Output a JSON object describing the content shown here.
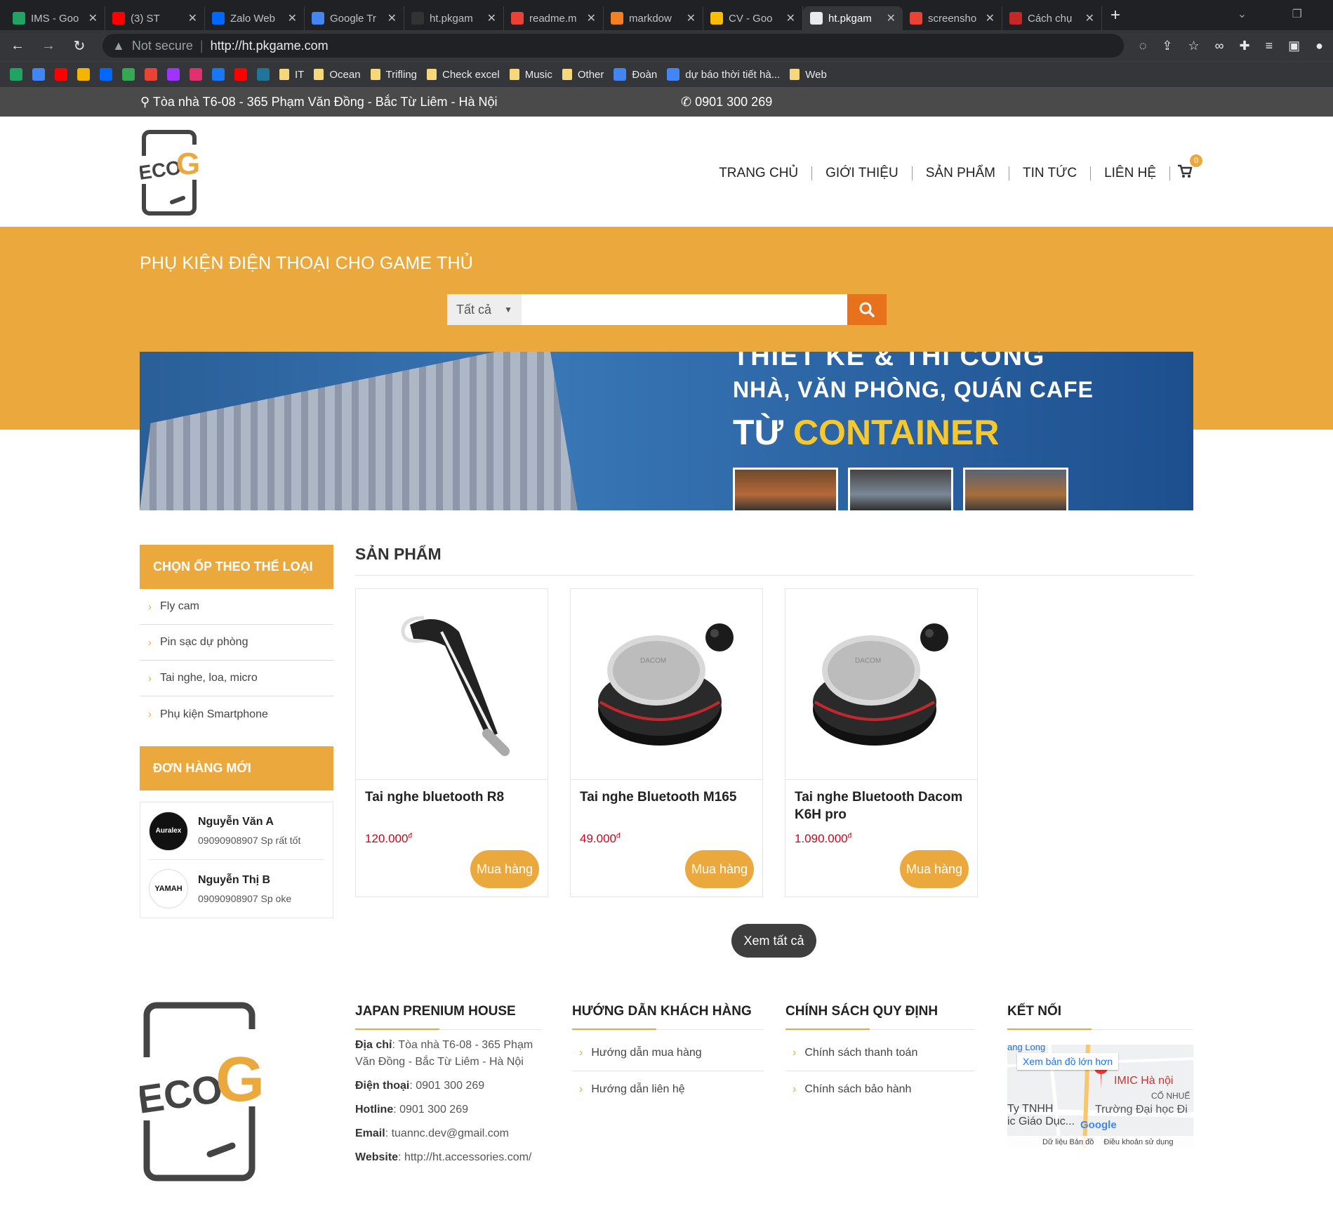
{
  "browser": {
    "tabs": [
      {
        "title": "IMS - Goo",
        "color": "#1fa463"
      },
      {
        "title": "(3) ST",
        "color": "#ff0000"
      },
      {
        "title": "Zalo Web",
        "color": "#0068ff"
      },
      {
        "title": "Google Tr",
        "color": "#4285f4"
      },
      {
        "title": "ht.pkgam",
        "color": "#333333"
      },
      {
        "title": "readme.m",
        "color": "#ea4335"
      },
      {
        "title": "markdow",
        "color": "#f48024"
      },
      {
        "title": "CV - Goo",
        "color": "#fbbc04"
      },
      {
        "title": "ht.pkgam",
        "color": "#e8eaed",
        "active": true
      },
      {
        "title": "screensho",
        "color": "#ea4335"
      },
      {
        "title": "Cách chụ",
        "color": "#c62828"
      }
    ],
    "security": "Not secure",
    "url": "http://ht.pkgame.com",
    "bookmarks": [
      {
        "label": "IT",
        "folder": true
      },
      {
        "label": "Ocean",
        "folder": true
      },
      {
        "label": "Trifling",
        "folder": true
      },
      {
        "label": "Check excel",
        "folder": true
      },
      {
        "label": "Music",
        "folder": true
      },
      {
        "label": "Other",
        "folder": true
      },
      {
        "label": "Đoàn",
        "folder": false
      },
      {
        "label": "dự báo thời tiết hà...",
        "folder": false
      },
      {
        "label": "Web",
        "folder": true
      }
    ]
  },
  "topbar": {
    "address": "Tòa nhà T6-08 - 365 Phạm Văn Đồng - Bắc Từ Liêm - Hà Nội",
    "phone": "0901 300 269"
  },
  "nav": {
    "items": [
      "TRANG CHỦ",
      "GIỚI THIỆU",
      "SẢN PHẨM",
      "TIN TỨC",
      "LIÊN HỆ"
    ],
    "cart_count": "0"
  },
  "logo": {
    "eco": "ECO",
    "g": "G"
  },
  "hero": {
    "title": "PHỤ KIỆN ĐIỆN THOẠI CHO GAME THỦ",
    "search_category": "Tất cả",
    "search_placeholder": ""
  },
  "banner": {
    "line1": "THIẾT KẾ & THI CÔNG",
    "line2": "NHÀ, VĂN PHÒNG, QUÁN CAFE",
    "line3_prefix": "TỪ",
    "line3_highlight": "CONTAINER"
  },
  "sidebar": {
    "categories_title": "CHỌN ỐP THEO THỂ LOẠI",
    "categories": [
      "Fly cam",
      "Pin sạc dự phòng",
      "Tai nghe, loa, micro",
      "Phụ kiện Smartphone"
    ],
    "orders_title": "ĐƠN HÀNG MỚI",
    "orders": [
      {
        "name": "Nguyễn Văn A",
        "message": "09090908907 Sp rất tốt",
        "avatar": "Auralex"
      },
      {
        "name": "Nguyễn Thị B",
        "message": "09090908907 Sp oke",
        "avatar": "YAMAH"
      }
    ]
  },
  "products": {
    "title": "SẢN PHẨM",
    "items": [
      {
        "name": "Tai nghe bluetooth R8",
        "price": "120.000",
        "currency": "đ",
        "buy": "Mua hàng"
      },
      {
        "name": "Tai nghe Bluetooth M165",
        "price": "49.000",
        "currency": "đ",
        "buy": "Mua hàng"
      },
      {
        "name": "Tai nghe Bluetooth Dacom K6H pro",
        "price": "1.090.000",
        "currency": "đ",
        "buy": "Mua hàng"
      }
    ],
    "view_all": "Xem tất cả"
  },
  "footer": {
    "company_title": "JAPAN PRENIUM HOUSE",
    "address_label": "Địa chỉ",
    "address": "Tòa nhà T6-08 - 365 Phạm Văn Đồng - Bắc Từ Liêm - Hà Nội",
    "phone_label": "Điện thoại",
    "phone": "0901 300 269",
    "hotline_label": "Hotline",
    "hotline": "0901 300 269",
    "email_label": "Email",
    "email": "tuannc.dev@gmail.com",
    "website_label": "Website",
    "website": "http://ht.accessories.com/",
    "guide_title": "HƯỚNG DẪN KHÁCH HÀNG",
    "guide_links": [
      "Hướng dẫn mua hàng",
      "Hướng dẫn liên hệ"
    ],
    "policy_title": "CHÍNH SÁCH QUY ĐỊNH",
    "policy_links": [
      "Chính sách thanh toán",
      "Chính sách bảo hành"
    ],
    "connect_title": "KẾT NỐI",
    "map": {
      "view_larger": "Xem bản đồ lớn hơn",
      "place": "IMIC Hà nội",
      "road": "ăng Long",
      "area": "CỔ NHUẾ",
      "school": "Trường Đại học Đi",
      "company": "Ty TNHH",
      "company2": "ic Giáo Dục...",
      "data": "Dữ liệu Bản đồ",
      "terms": "Điều khoản sử dụng",
      "brand": "Google"
    }
  },
  "colors": {
    "accent": "#eba83d",
    "search_button": "#e8721c",
    "price": "#d0021b",
    "topbar": "#4a4a4a"
  }
}
